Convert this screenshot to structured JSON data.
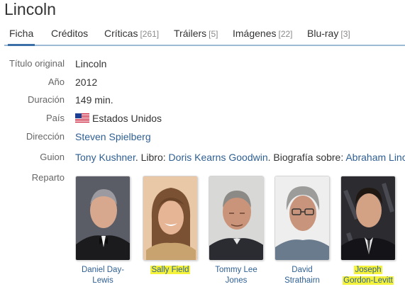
{
  "title": "Lincoln",
  "tabs": [
    {
      "label": "Ficha",
      "count": ""
    },
    {
      "label": "Créditos",
      "count": ""
    },
    {
      "label": "Críticas",
      "count": "[261]"
    },
    {
      "label": "Tráilers",
      "count": "[5]"
    },
    {
      "label": "Imágenes",
      "count": "[22]"
    },
    {
      "label": "Blu-ray",
      "count": "[3]"
    }
  ],
  "info": {
    "titulo_original": {
      "label": "Título original",
      "value": "Lincoln"
    },
    "anio": {
      "label": "Año",
      "value": "2012"
    },
    "duracion": {
      "label": "Duración",
      "value": "149 min."
    },
    "pais": {
      "label": "País",
      "value": "Estados Unidos",
      "flag_icon": "us-flag-icon"
    },
    "direccion": {
      "label": "Dirección",
      "value": "Steven Spielberg"
    },
    "guion": {
      "label": "Guion",
      "writer": "Tony Kushner",
      "sep1": ". Libro: ",
      "book_author": "Doris Kearns Goodwin",
      "sep2": ". Biografía sobre: ",
      "subject": "Abraham Linc"
    },
    "reparto": {
      "label": "Reparto"
    }
  },
  "cast": [
    {
      "name_line1": "Daniel Day-",
      "name_line2": "Lewis",
      "highlighted": false
    },
    {
      "name_line1": "Sally Field",
      "name_line2": "",
      "highlighted": true
    },
    {
      "name_line1": "Tommy Lee",
      "name_line2": "Jones",
      "highlighted": false
    },
    {
      "name_line1": "David",
      "name_line2": "Strathairn",
      "highlighted": false
    },
    {
      "name_line1": "Joseph",
      "name_line2": "Gordon-Levitt",
      "highlighted": true
    }
  ],
  "colors": {
    "link": "#2e5f93",
    "tab_underline": "#3a6fa8",
    "highlight": "#f4f23a"
  }
}
